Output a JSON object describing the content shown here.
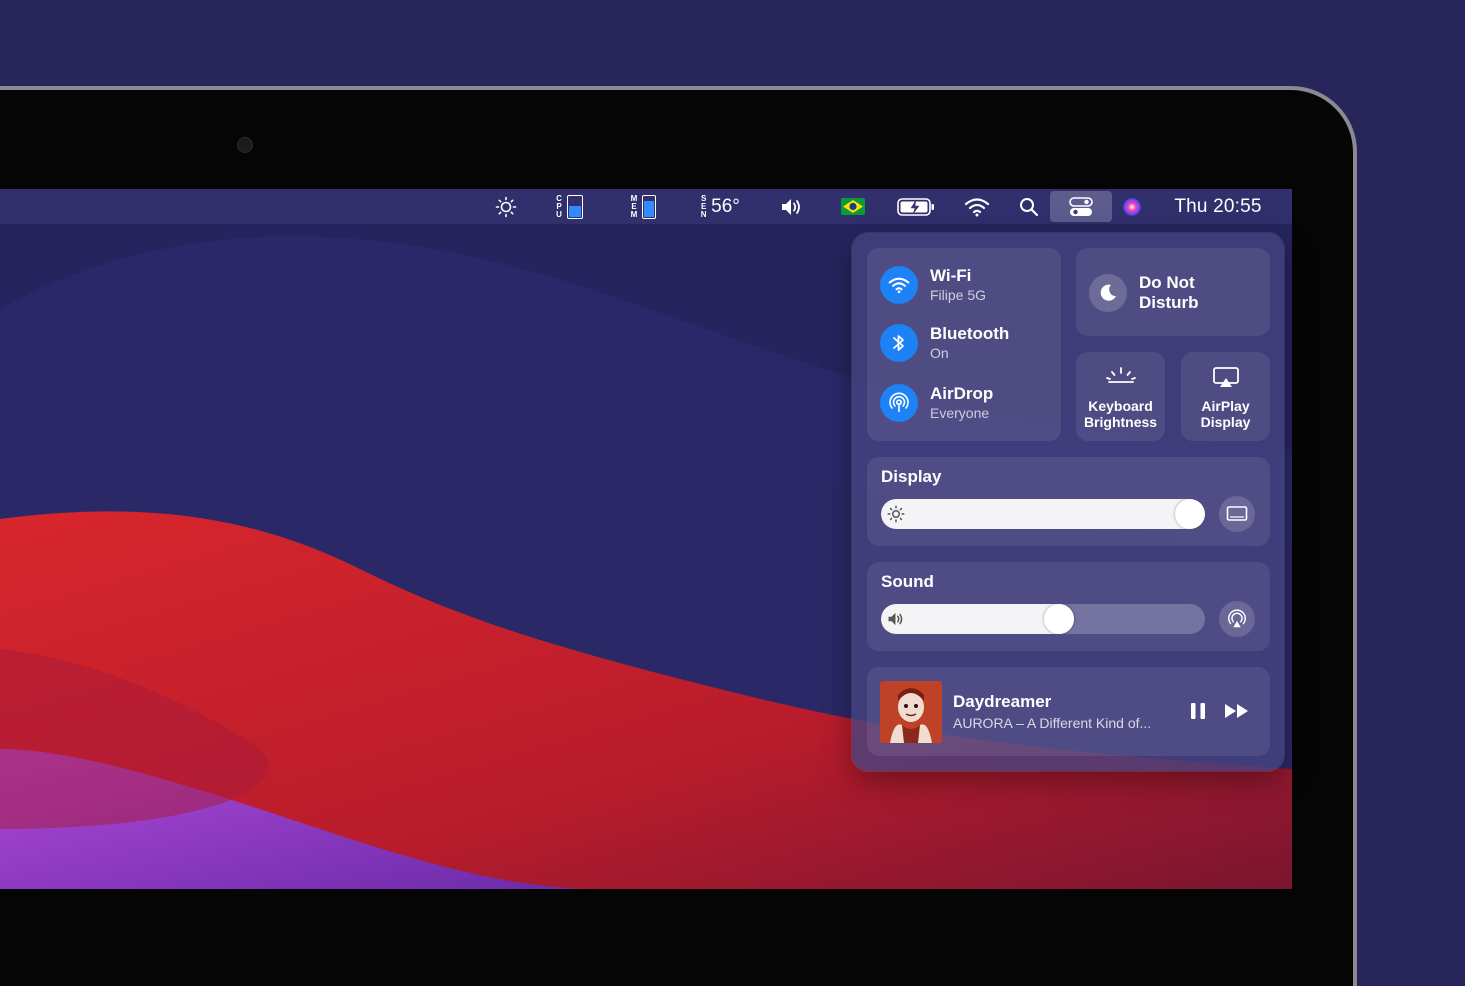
{
  "menubar": {
    "cpu_label": "CPU",
    "cpu_load": 0.55,
    "mem_label": "MEM",
    "mem_load": 0.8,
    "sen_label": "SEN",
    "temperature": "56°",
    "clock": "Thu 20:55",
    "icons": [
      "brightness-icon",
      "cpu-meter-icon",
      "memory-meter-icon",
      "sensor-icon",
      "volume-icon",
      "brazil-flag-icon",
      "battery-icon",
      "wifi-icon",
      "search-icon",
      "control-center-icon",
      "siri-icon"
    ]
  },
  "control_center": {
    "wifi": {
      "title": "Wi-Fi",
      "subtitle": "Filipe 5G"
    },
    "bluetooth": {
      "title": "Bluetooth",
      "subtitle": "On"
    },
    "airdrop": {
      "title": "AirDrop",
      "subtitle": "Everyone"
    },
    "dnd": {
      "line1": "Do Not",
      "line2": "Disturb"
    },
    "keyboard_brightness": {
      "line1": "Keyboard",
      "line2": "Brightness"
    },
    "airplay_display": {
      "line1": "AirPlay",
      "line2": "Display"
    },
    "display": {
      "title": "Display",
      "level": 0.96
    },
    "sound": {
      "title": "Sound",
      "level": 0.55
    },
    "now_playing": {
      "title": "Daydreamer",
      "artist": "AURORA – A Different Kind of..."
    }
  },
  "colors": {
    "accent": "#1d82f5",
    "desktop_bg": "#28255a",
    "wallpaper_red": "#c8222c",
    "wallpaper_purple": "#8a3ed6"
  }
}
